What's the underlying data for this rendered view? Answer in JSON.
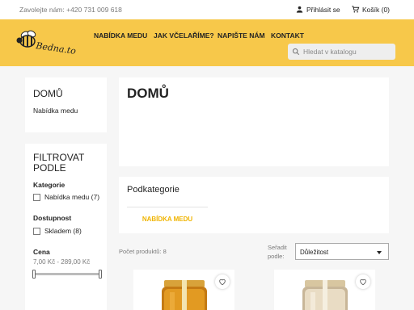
{
  "topbar": {
    "contact": "Zavolejte nám: +420 731 009 618",
    "login": "Přihlásit se",
    "cart": "Košík (0)"
  },
  "header": {
    "logo_icon": "bee-logo",
    "logo_text": "Bedna.to",
    "nav": [
      "NABÍDKA MEDU",
      "JAK VČELAŘÍME?",
      "NAPIŠTE NÁM",
      "KONTAKT"
    ],
    "search_placeholder": "Hledat v katalogu"
  },
  "sidebar": {
    "category_title": "DOMŮ",
    "category_link": "Nabídka medu",
    "filter_title": "FILTROVAT PODLE",
    "filters": {
      "category_label": "Kategorie",
      "category_option": "Nabídka medu (7)",
      "availability_label": "Dostupnost",
      "availability_option": "Skladem (8)",
      "price_label": "Cena",
      "price_range": "7,00 Kč - 289,00 Kč"
    }
  },
  "main": {
    "title": "DOMŮ",
    "subcategories_title": "Podkategorie",
    "subcategory": "NABÍDKA MEDU",
    "product_count": "Počet produktů: 8",
    "sort_label_1": "Seřadit",
    "sort_label_2": "podle:",
    "sort_value": "Důležitost"
  },
  "colors": {
    "brand_yellow": "#f7c84a",
    "accent": "#f0b400",
    "page_bg": "#f6f6f6"
  }
}
